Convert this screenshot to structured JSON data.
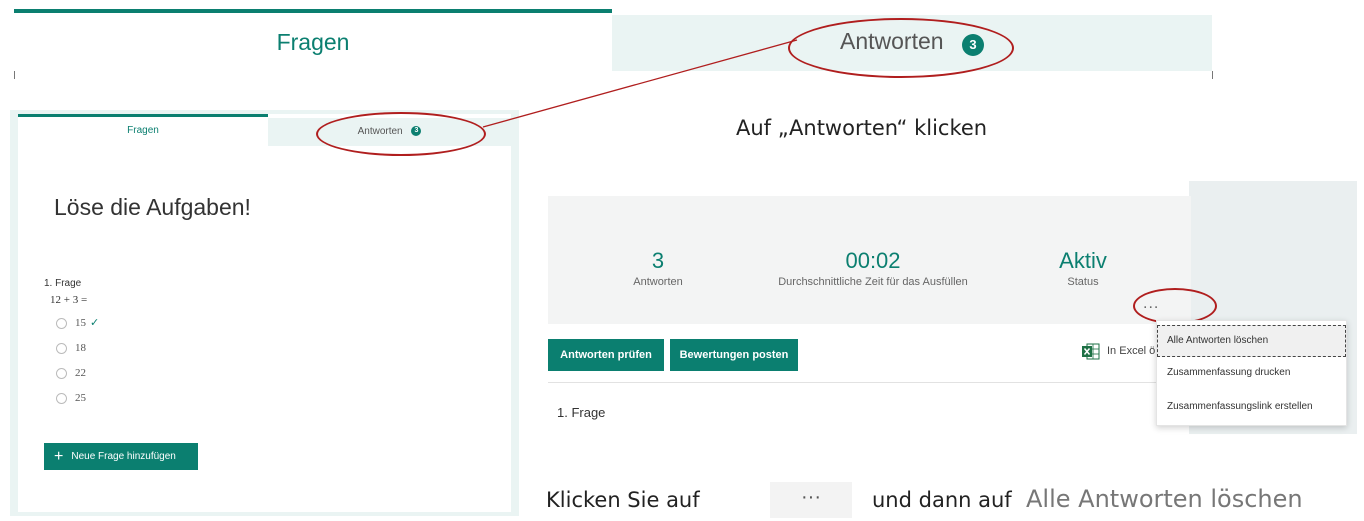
{
  "top_tabs": {
    "fragen": "Fragen",
    "antworten": "Antworten",
    "antworten_count": "3"
  },
  "form_preview": {
    "tabs": {
      "fragen": "Fragen",
      "antworten": "Antworten",
      "antworten_count": "3"
    },
    "title": "Löse die Aufgaben!",
    "question_label": "1. Frage",
    "question_expr": "12 + 3 =",
    "options": [
      "15",
      "18",
      "22",
      "25"
    ],
    "correct_mark": "✓",
    "add_button": "Neue Frage hinzufügen"
  },
  "instructions": {
    "step1": "Auf „Antworten“ klicken",
    "step2_prefix": "Klicken Sie auf",
    "step2_dots": "···",
    "step2_mid": "und dann auf",
    "step2_command": "Alle Antworten löschen"
  },
  "responses": {
    "stats": [
      {
        "value": "3",
        "label": "Antworten"
      },
      {
        "value": "00:02",
        "label": "Durchschnittliche Zeit für das Ausfüllen"
      },
      {
        "value": "Aktiv",
        "label": "Status"
      }
    ],
    "more_label": "...",
    "review_button": "Antworten prüfen",
    "post_button": "Bewertungen posten",
    "excel_label": "In Excel ö",
    "first_question": "1. Frage"
  },
  "menu": {
    "items": [
      "Alle Antworten löschen",
      "Zusammenfassung drucken",
      "Zusammenfassungslink erstellen"
    ]
  },
  "colors": {
    "accent": "#0b7f70",
    "highlight": "#b01e1e",
    "tab_bg": "#eaf4f3"
  },
  "icons": [
    "excel-icon",
    "plus-icon",
    "check-icon",
    "radio-icon",
    "more-icon"
  ]
}
